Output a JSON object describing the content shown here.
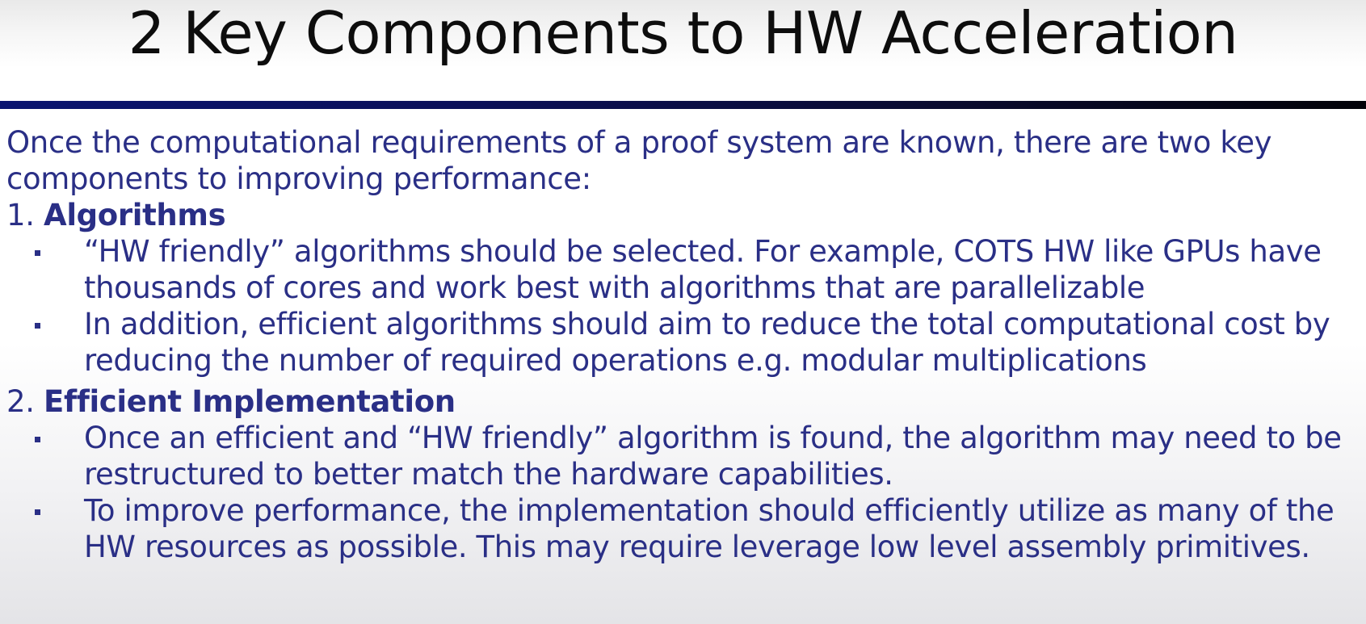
{
  "title": "2 Key Components to HW Acceleration",
  "intro": "Once the computational requirements of a proof system are known, there are two key components to improving performance:",
  "sections": [
    {
      "number": "1.",
      "label": "Algorithms",
      "bullets": [
        "“HW friendly” algorithms should be selected. For example, COTS HW like GPUs have thousands of cores and work best with algorithms that are parallelizable",
        "In addition, efficient algorithms should aim to reduce the total computational cost by reducing the number of required operations e.g. modular multiplications"
      ]
    },
    {
      "number": "2.",
      "label": "Efficient Implementation",
      "bullets": [
        "Once an efficient and “HW friendly” algorithm is found, the algorithm may need to be restructured to better match the hardware capabilities.",
        "To improve performance, the implementation should efficiently utilize as many of the HW resources as possible. This may require leverage low level assembly primitives."
      ]
    }
  ],
  "colors": {
    "title_text": "#0d0d0d",
    "body_text": "#2a2f86",
    "rule": "#0a1470"
  }
}
